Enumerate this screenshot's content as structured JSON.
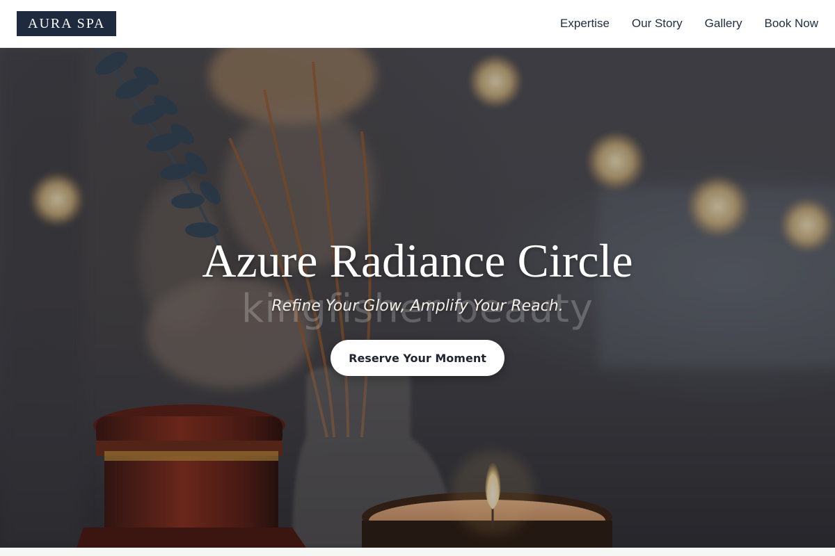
{
  "brand": {
    "logo_text": "AURA SPA"
  },
  "nav": {
    "items": [
      {
        "label": "Expertise"
      },
      {
        "label": "Our Story"
      },
      {
        "label": "Gallery"
      },
      {
        "label": "Book Now"
      }
    ]
  },
  "hero": {
    "title": "Azure Radiance Circle",
    "watermark": "kingfisher beauty",
    "tagline": "Refine Your Glow, Amplify Your Reach.",
    "cta_label": "Reserve Your Moment"
  },
  "colors": {
    "logo_bg": "#1e2a3e",
    "nav_text": "#1f2d40",
    "cta_bg": "#ffffff",
    "cta_text": "#1f2430"
  }
}
